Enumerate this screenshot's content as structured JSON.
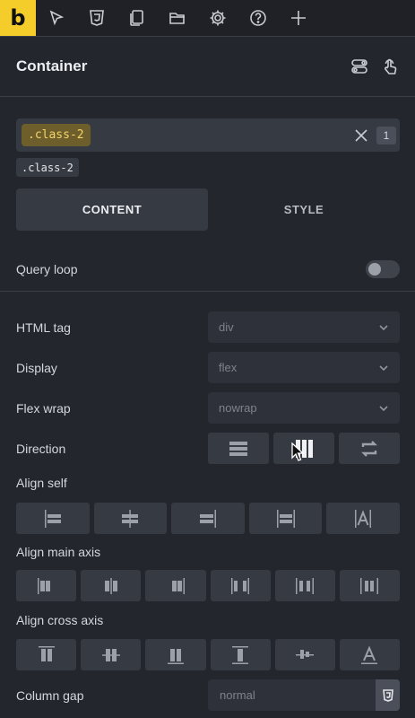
{
  "toolbar": {
    "logo": "b",
    "buttons": [
      {
        "icon": "cursor-arrow-icon"
      },
      {
        "icon": "css3-icon"
      },
      {
        "icon": "pages-icon"
      },
      {
        "icon": "folder-icon"
      },
      {
        "icon": "gear-icon"
      },
      {
        "icon": "help-icon"
      },
      {
        "icon": "plus-icon"
      }
    ]
  },
  "header": {
    "title": "Container",
    "icons": [
      "toggle-switch-icon",
      "pointer-touch-icon"
    ]
  },
  "class_field": {
    "chip": ".class-2",
    "count": "1"
  },
  "class_tag": ".class-2",
  "tabs": [
    {
      "label": "CONTENT",
      "active": true
    },
    {
      "label": "STYLE",
      "active": false
    }
  ],
  "query_loop": {
    "label": "Query loop",
    "enabled": false
  },
  "fields": {
    "html_tag": {
      "label": "HTML tag",
      "value": "div"
    },
    "display": {
      "label": "Display",
      "value": "flex"
    },
    "flex_wrap": {
      "label": "Flex wrap",
      "value": "nowrap"
    },
    "direction": {
      "label": "Direction",
      "options": [
        "column",
        "row",
        "reverse"
      ],
      "selected": "row"
    },
    "align_self": {
      "label": "Align self"
    },
    "align_main_axis": {
      "label": "Align main axis"
    },
    "align_cross_axis": {
      "label": "Align cross axis"
    },
    "column_gap": {
      "label": "Column gap",
      "placeholder": "normal"
    }
  },
  "colors": {
    "brand": "#f5cd2b",
    "background": "#23262d",
    "chip_bg": "#6d5e2b",
    "chip_text": "#f2d56a"
  }
}
